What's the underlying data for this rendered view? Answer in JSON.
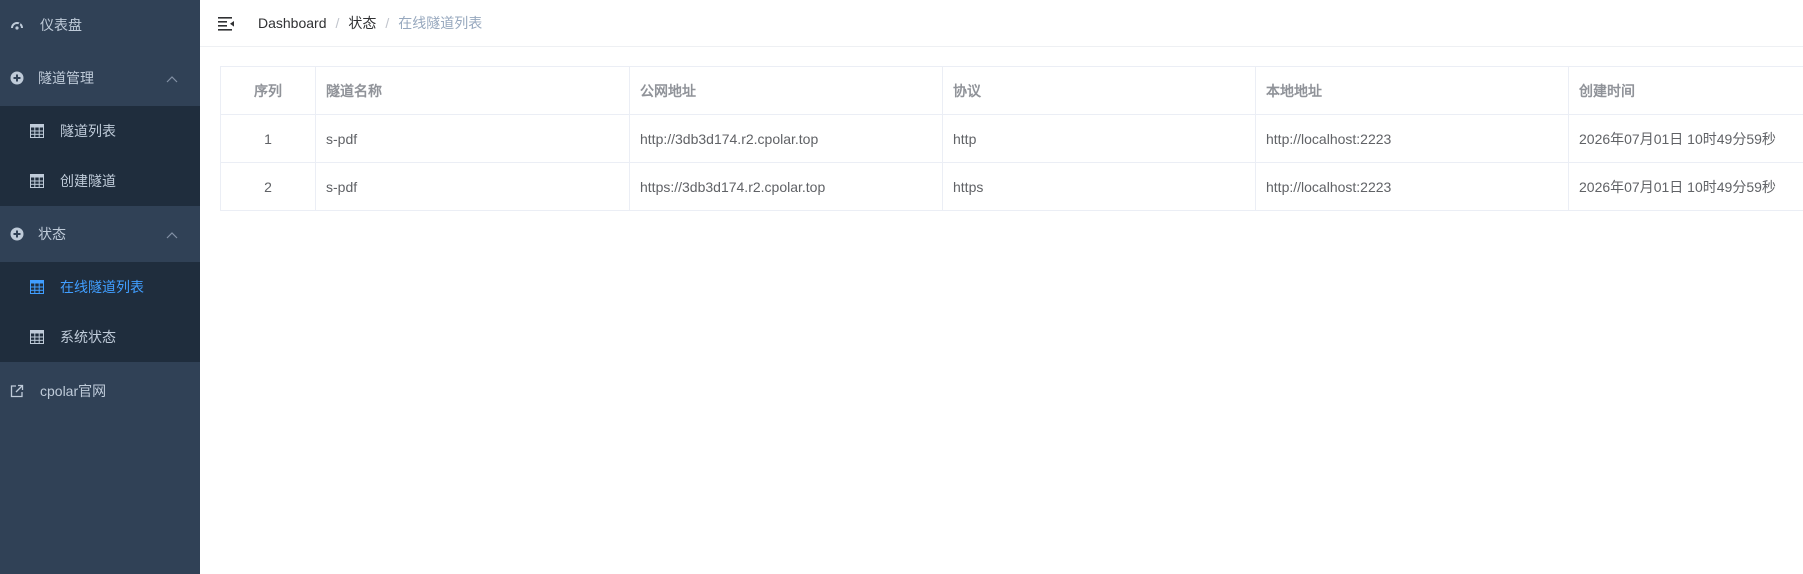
{
  "sidebar": {
    "dashboard": {
      "label": "仪表盘",
      "icon": "dashboard-icon"
    },
    "tunnel_management": {
      "label": "隧道管理",
      "icon": "plus-circle-icon",
      "items": [
        {
          "label": "隧道列表",
          "icon": "table-icon"
        },
        {
          "label": "创建隧道",
          "icon": "table-icon"
        }
      ]
    },
    "status": {
      "label": "状态",
      "icon": "plus-circle-icon",
      "items": [
        {
          "label": "在线隧道列表",
          "icon": "table-icon",
          "active": true
        },
        {
          "label": "系统状态",
          "icon": "table-icon"
        }
      ]
    },
    "cpolar_site": {
      "label": "cpolar官网",
      "icon": "external-link-icon"
    }
  },
  "breadcrumb": [
    "Dashboard",
    "状态",
    "在线隧道列表"
  ],
  "table": {
    "headers": [
      "序列",
      "隧道名称",
      "公网地址",
      "协议",
      "本地地址",
      "创建时间"
    ],
    "rows": [
      [
        "1",
        "s-pdf",
        "http://3db3d174.r2.cpolar.top",
        "http",
        "http://localhost:2223",
        "2026年07月01日 10时49分59秒"
      ],
      [
        "2",
        "s-pdf",
        "https://3db3d174.r2.cpolar.top",
        "https",
        "http://localhost:2223",
        "2026年07月01日 10时49分59秒"
      ]
    ]
  },
  "colors": {
    "sidebar_bg": "#304156",
    "submenu_bg": "#1f2d3d",
    "sidebar_text": "#bfcbd9",
    "active": "#409eff"
  }
}
